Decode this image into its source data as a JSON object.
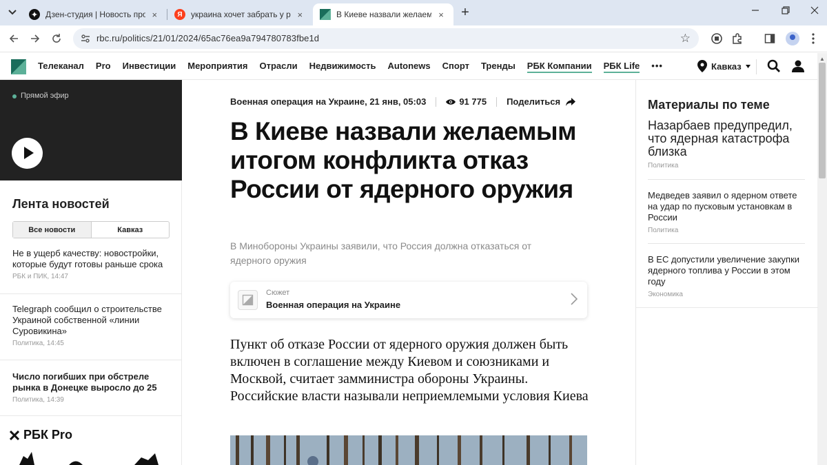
{
  "browser": {
    "tabs": [
      {
        "title": "Дзен-студия | Новость про ЯО",
        "close": "×"
      },
      {
        "title": "украина хочет забрать у росси",
        "close": "×"
      },
      {
        "title": "В Киеве назвали желаемым ит",
        "close": "×"
      }
    ],
    "new_tab": "+",
    "url": "rbc.ru/politics/21/01/2024/65ac76ea9a794780783fbe1d"
  },
  "site": {
    "nav": [
      "Телеканал",
      "Pro",
      "Инвестиции",
      "Мероприятия",
      "Отрасли",
      "Недвижимость",
      "Autonews",
      "Спорт",
      "Тренды",
      "РБК Компании",
      "РБК Life"
    ],
    "more": "•••",
    "region": "Кавказ",
    "accent_color": "#5cb098"
  },
  "live": {
    "label": "Прямой эфир"
  },
  "feed": {
    "title": "Лента новостей",
    "tabs": [
      "Все новости",
      "Кавказ"
    ],
    "items": [
      {
        "title": "Не в ущерб качеству: новостройки, которые будут готовы раньше срока",
        "meta": "РБК и ПИК, 14:47",
        "bold": false
      },
      {
        "title": "Telegraph сообщил о строительстве Украиной собственной «линии Суровикина»",
        "meta": "Политика, 14:45",
        "bold": false
      },
      {
        "title": "Число погибших при обстреле рынка в Донецке выросло до 25",
        "meta": "Политика, 14:39",
        "bold": true
      }
    ],
    "pro_logo": "РБК Pro"
  },
  "article": {
    "meta_story": "Военная операция на Украине, 21 янв, 05:03",
    "views": "91 775",
    "share": "Поделиться",
    "headline": "В Киеве назвали желаемым итогом конфликта отказ России от ядерного оружия",
    "subtitle": "В Минобороны Украины заявили, что Россия должна отказаться от ядерного оружия",
    "story_card": {
      "label": "Сюжет",
      "title": "Военная операция на Украине"
    },
    "lead": "Пункт об отказе России от ядерного оружия должен быть включен в соглашение между Киевом и союзниками и Москвой, считает замминистра обороны Украины. Российские власти называли неприемлемыми условия Киева"
  },
  "related": {
    "title": "Материалы по теме",
    "items": [
      {
        "title": "Назарбаев предупредил, что ядерная катастрофа близка",
        "meta": "Политика"
      },
      {
        "title": "Медведев заявил о ядерном ответе на удар по пусковым установкам в России",
        "meta": "Политика"
      },
      {
        "title": "В ЕС допустили увеличение закупки ядерного топлива у России в этом году",
        "meta": "Экономика"
      }
    ]
  }
}
